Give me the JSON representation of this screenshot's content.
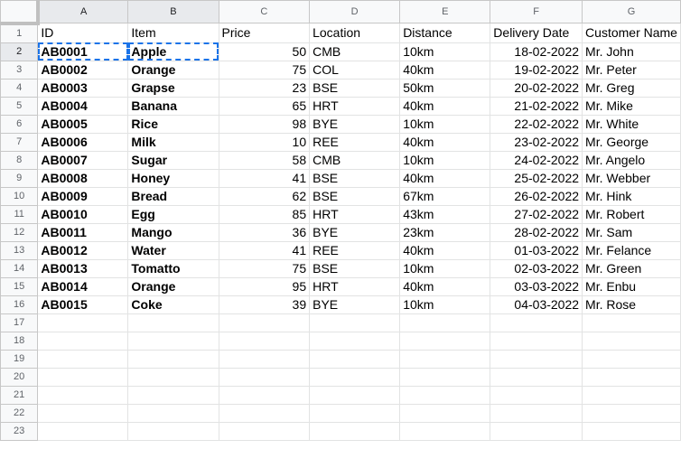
{
  "columns": [
    "A",
    "B",
    "C",
    "D",
    "E",
    "F",
    "G"
  ],
  "row_numbers": [
    "1",
    "2",
    "3",
    "4",
    "5",
    "6",
    "7",
    "8",
    "9",
    "10",
    "11",
    "12",
    "13",
    "14",
    "15",
    "16",
    "17",
    "18",
    "19",
    "20",
    "21",
    "22",
    "23"
  ],
  "headers": [
    "ID",
    "Item",
    "Price",
    "Location",
    "Distance",
    "Delivery Date",
    "Customer Name"
  ],
  "rows": [
    [
      "AB0001",
      "Apple",
      "50",
      "CMB",
      "10km",
      "18-02-2022",
      "Mr. John"
    ],
    [
      "AB0002",
      "Orange",
      "75",
      "COL",
      "40km",
      "19-02-2022",
      "Mr. Peter"
    ],
    [
      "AB0003",
      "Grapse",
      "23",
      "BSE",
      "50km",
      "20-02-2022",
      "Mr. Greg"
    ],
    [
      "AB0004",
      "Banana",
      "65",
      "HRT",
      "40km",
      "21-02-2022",
      "Mr. Mike"
    ],
    [
      "AB0005",
      "Rice",
      "98",
      "BYE",
      "10km",
      "22-02-2022",
      "Mr. White"
    ],
    [
      "AB0006",
      "Milk",
      "10",
      "REE",
      "40km",
      "23-02-2022",
      "Mr. George"
    ],
    [
      "AB0007",
      "Sugar",
      "58",
      "CMB",
      "10km",
      "24-02-2022",
      "Mr. Angelo"
    ],
    [
      "AB0008",
      "Honey",
      "41",
      "BSE",
      "40km",
      "25-02-2022",
      "Mr. Webber"
    ],
    [
      "AB0009",
      "Bread",
      "62",
      "BSE",
      "67km",
      "26-02-2022",
      "Mr. Hink"
    ],
    [
      "AB0010",
      "Egg",
      "85",
      "HRT",
      "43km",
      "27-02-2022",
      "Mr. Robert"
    ],
    [
      "AB0011",
      "Mango",
      "36",
      "BYE",
      "23km",
      "28-02-2022",
      "Mr. Sam"
    ],
    [
      "AB0012",
      "Water",
      "41",
      "REE",
      "40km",
      "01-03-2022",
      "Mr. Felance"
    ],
    [
      "AB0013",
      "Tomatto",
      "75",
      "BSE",
      "10km",
      "02-03-2022",
      "Mr. Green"
    ],
    [
      "AB0014",
      "Orange",
      "95",
      "HRT",
      "40km",
      "03-03-2022",
      "Mr. Enbu"
    ],
    [
      "AB0015",
      "Coke",
      "39",
      "BYE",
      "10km",
      "04-03-2022",
      "Mr. Rose"
    ]
  ],
  "selection": {
    "range": "A2:B2",
    "style": "dashed-copy",
    "color": "#1a73e8"
  }
}
